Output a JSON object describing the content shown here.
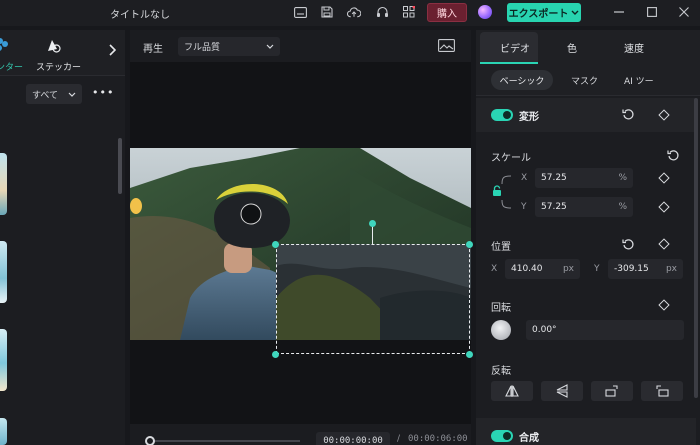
{
  "window": {
    "title": "タイトルなし",
    "buy_label": "購入",
    "export_label": "エクスポート"
  },
  "left_panel": {
    "tab_partial_label": "ンター",
    "sticker_label": "ステッカー",
    "filter_value": "すべて",
    "more": "•••"
  },
  "preview": {
    "play_label": "再生",
    "quality_value": "フル品質",
    "timecode_current": "00:00:00:00",
    "timecode_separator": "/",
    "timecode_total": "00:00:06:00"
  },
  "right_panel": {
    "tabs": [
      "ビデオ",
      "色",
      "速度"
    ],
    "subtabs": [
      "ベーシック",
      "マスク",
      "AI ツー"
    ],
    "transform": {
      "title": "変形",
      "enabled": true,
      "scale_label": "スケール",
      "scale_x_axis": "X",
      "scale_x": "57.25",
      "scale_y_axis": "Y",
      "scale_y": "57.25",
      "scale_unit": "%",
      "position_label": "位置",
      "pos_x_axis": "X",
      "pos_x": "410.40",
      "pos_y_axis": "Y",
      "pos_y": "-309.15",
      "pos_unit": "px",
      "rotate_label": "回転",
      "rotate_value": "0.00°",
      "flip_label": "反転"
    },
    "composite": {
      "title": "合成",
      "enabled": true
    }
  },
  "colors": {
    "accent": "#2ad4b4",
    "buy": "#6b2030",
    "panel": "#1c1d21"
  },
  "icons": [
    "captions-icon",
    "save-icon",
    "cloud-upload-icon",
    "headset-icon",
    "grid-icon",
    "reset-icon",
    "keyframe-icon",
    "lock-icon",
    "screenshot-icon"
  ]
}
